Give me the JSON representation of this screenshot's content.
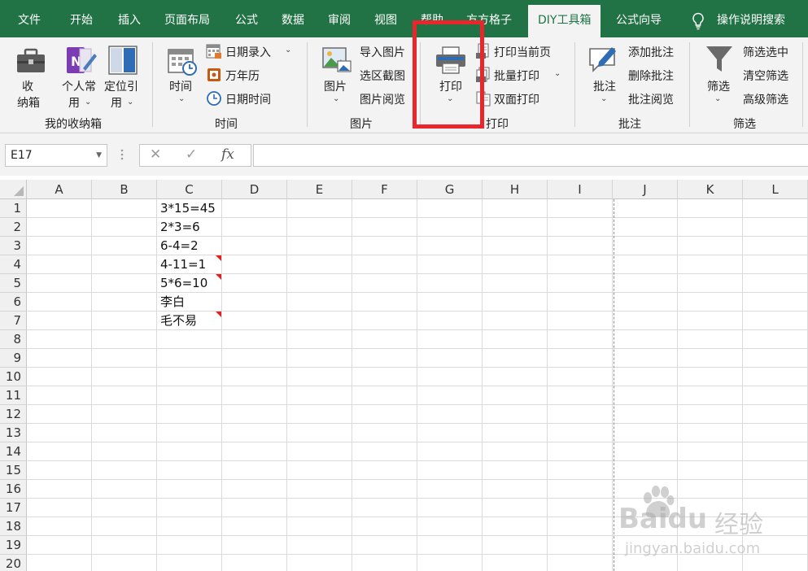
{
  "tabs": [
    "文件",
    "开始",
    "插入",
    "页面布局",
    "公式",
    "数据",
    "审阅",
    "视图",
    "帮助",
    "方方格子",
    "DIY工具箱",
    "公式向导"
  ],
  "active_tab": "DIY工具箱",
  "tell_me": "操作说明搜索",
  "ribbon": {
    "my_box": {
      "btn1_l1": "收",
      "btn1_l2": "纳箱",
      "btn2_l1": "个人常",
      "btn2_l2": "用",
      "btn3_l1": "定位引",
      "btn3_l2": "用",
      "group": "我的收纳箱"
    },
    "time": {
      "big": "时间",
      "item1": "日期录入",
      "item2": "万年历",
      "item3": "日期时间",
      "group": "时间"
    },
    "picture": {
      "big": "图片",
      "item1": "导入图片",
      "item2": "选区截图",
      "item3": "图片阅览",
      "group": "图片"
    },
    "print": {
      "big": "打印",
      "item1": "打印当前页",
      "item2": "批量打印",
      "item3": "双面打印",
      "group": "打印"
    },
    "comment": {
      "big": "批注",
      "item1": "添加批注",
      "item2": "删除批注",
      "item3": "批注阅览",
      "group": "批注"
    },
    "filter": {
      "big": "筛选",
      "item1": "筛选选中",
      "item2": "清空筛选",
      "item3": "高级筛选",
      "group": "筛选"
    }
  },
  "formula_bar": {
    "name_box": "E17",
    "fx": "fx",
    "value": ""
  },
  "grid": {
    "columns": [
      "A",
      "B",
      "C",
      "D",
      "E",
      "F",
      "G",
      "H",
      "I",
      "J",
      "K",
      "L"
    ],
    "rows": [
      "1",
      "2",
      "3",
      "4",
      "5",
      "6",
      "7",
      "8",
      "9",
      "10",
      "11",
      "12",
      "13",
      "14",
      "15",
      "16",
      "17",
      "18",
      "19",
      "20"
    ],
    "c_values": [
      "3*15=45",
      "2*3=6",
      "6-4=2",
      "4-11=1",
      "5*6=10",
      "李白",
      "毛不易"
    ],
    "comment_rows": [
      4,
      5,
      7
    ]
  },
  "watermark": {
    "brand": "Baidu",
    "cn": "经验",
    "url": "jingyan.baidu.com"
  },
  "colors": {
    "excel_green": "#217346",
    "highlight_red": "#e8262b",
    "comment_red": "#e1201f"
  }
}
